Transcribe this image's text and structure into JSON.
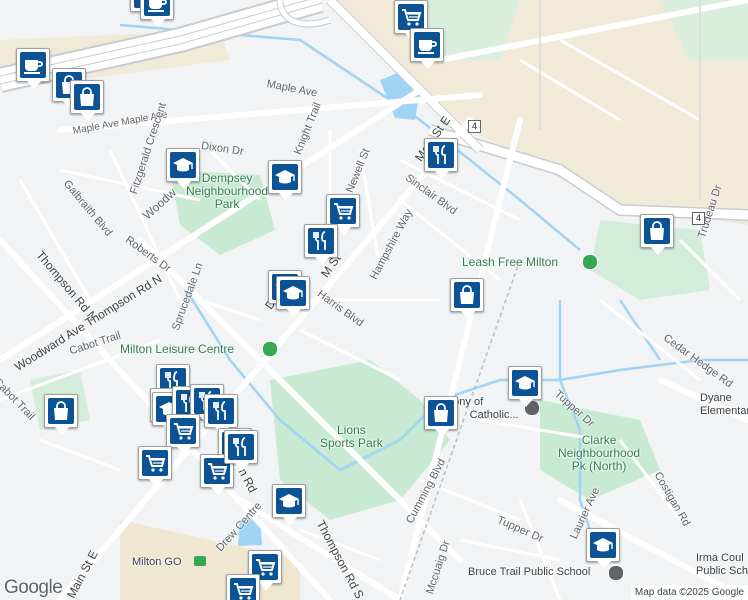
{
  "map": {
    "attribution": "Map data ©2025 Google",
    "logo": "Google"
  },
  "streets": [
    {
      "id": "maple-ave",
      "text": "Maple Ave"
    },
    {
      "id": "maple-ave-2",
      "text": "Maple Ave Maple Ave"
    },
    {
      "id": "dixon-dr",
      "text": "Dixon Dr"
    },
    {
      "id": "knight-trail",
      "text": "Knight Trail"
    },
    {
      "id": "newell-st",
      "text": "Newell St"
    },
    {
      "id": "fitzgerald-cres",
      "text": "Fitzgerald Crescent"
    },
    {
      "id": "woodward",
      "text": "Woodw"
    },
    {
      "id": "galbraith-blvd",
      "text": "Galbraith Blvd"
    },
    {
      "id": "roberts-dr",
      "text": "Roberts Dr"
    },
    {
      "id": "main-st-e-n",
      "text": "Main St E"
    },
    {
      "id": "sinclair-blvd",
      "text": "Sinclair Blvd"
    },
    {
      "id": "hampshire-way",
      "text": "Hampshire Way"
    },
    {
      "id": "main-st-mid",
      "text": "M   St"
    },
    {
      "id": "thompson-rd-n",
      "text": "Thompson Rd N"
    },
    {
      "id": "woodward-ave",
      "text": "Woodward Ave Thompson Rd N"
    },
    {
      "id": "spruce",
      "text": "Sprucedale Ln"
    },
    {
      "id": "harris-blvd",
      "text": "Harris Blvd"
    },
    {
      "id": "cabot-trail",
      "text": "Cabot Trail"
    },
    {
      "id": "cabot-trail-2",
      "text": "Cabot Trail"
    },
    {
      "id": "trudeau",
      "text": "Trudeau Dr"
    },
    {
      "id": "cedar-hedge",
      "text": "Cedar Hedge Rd"
    },
    {
      "id": "tupper-dr",
      "text": "Tupper Dr"
    },
    {
      "id": "tupper-dr-2",
      "text": "Tupper Dr"
    },
    {
      "id": "laurier",
      "text": "Laurier Ave"
    },
    {
      "id": "costigan",
      "text": "Costigan Rd"
    },
    {
      "id": "cumming",
      "text": "Cumming Blvd"
    },
    {
      "id": "mccuaig",
      "text": "Mccuaig Dr"
    },
    {
      "id": "drew",
      "text": "Drew Centre"
    },
    {
      "id": "thompson-s",
      "text": "Thompson Rd S"
    },
    {
      "id": "main-st-e-s",
      "text": "Main St E"
    },
    {
      "id": "rd-frag",
      "text": "n Rd"
    },
    {
      "id": "d-frag",
      "text": "D"
    }
  ],
  "places": [
    {
      "id": "dempsey-park",
      "text": "Dempsey\nNeighbourhood\nPark"
    },
    {
      "id": "leash-free",
      "text": "Leash Free Milton"
    },
    {
      "id": "leisure-centre",
      "text": "Milton Leisure Centre"
    },
    {
      "id": "lions-park",
      "text": "Lions\nSports Park"
    },
    {
      "id": "st-anthony",
      "text": "thony of\nPa    Catholic..."
    },
    {
      "id": "clarke-park",
      "text": "Clarke\nNeighbourhood\nPk (North)"
    },
    {
      "id": "dyane",
      "text": "Dyane\nElementary"
    },
    {
      "id": "milton-go",
      "text": "Milton GO"
    },
    {
      "id": "bruce-trail",
      "text": "Bruce Trail Public School"
    },
    {
      "id": "irma",
      "text": "Irma Coul\nPublic Sch"
    }
  ],
  "routes": [
    "4",
    "4"
  ],
  "markers": [
    {
      "type": "shopping-cart",
      "name": "shopping-cart-icon"
    },
    {
      "type": "coffee",
      "name": "coffee-cup-icon"
    },
    {
      "type": "coffee",
      "name": "coffee-cup-icon"
    },
    {
      "type": "shopping-bag",
      "name": "shopping-bag-icon"
    },
    {
      "type": "school",
      "name": "school-cap-icon"
    },
    {
      "type": "restaurant",
      "name": "restaurant-icon"
    }
  ]
}
